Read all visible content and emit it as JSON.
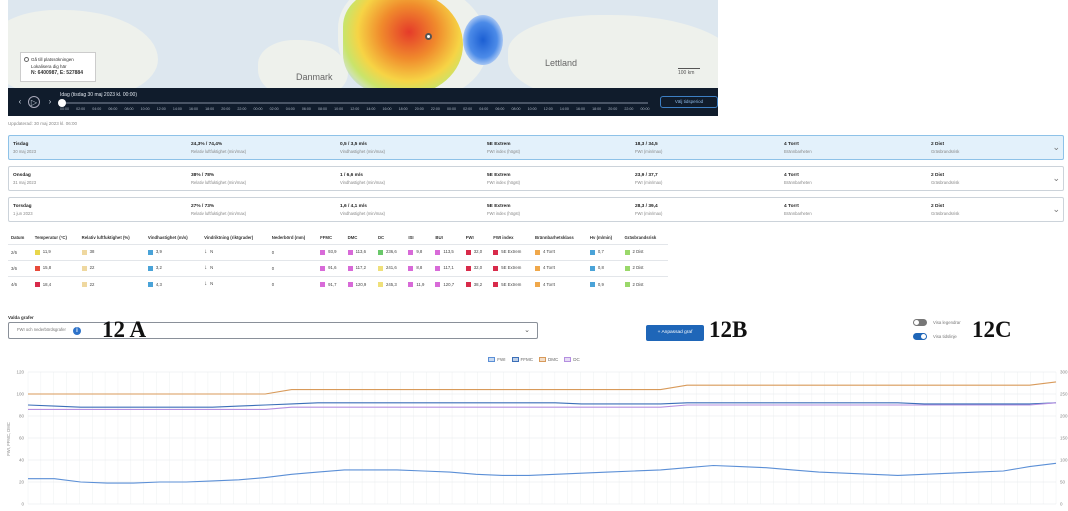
{
  "map": {
    "labels": [
      "Danmark",
      "Lettland"
    ],
    "location_box": {
      "line1": "Gå till platssökningen",
      "line2": "Lokalisera dig här",
      "coords": "N: 6400987, E: 527884"
    },
    "scale": "100 km"
  },
  "timebar": {
    "date_label": "Idag (tisdag 30 maj 2023 kl. 00:00)",
    "hours": [
      "00:00",
      "02:00",
      "04:00",
      "06:00",
      "08:00",
      "10:00",
      "12:00",
      "14:00",
      "16:00",
      "18:00",
      "20:00",
      "22:00",
      "00:00",
      "02:00",
      "04:00",
      "06:00",
      "08:00",
      "10:00",
      "12:00",
      "14:00",
      "16:00",
      "18:00",
      "20:00",
      "22:00",
      "00:00",
      "02:00",
      "04:00",
      "06:00",
      "08:00",
      "10:00",
      "12:00",
      "14:00",
      "16:00",
      "18:00",
      "20:00",
      "22:00",
      "00:00"
    ],
    "selected_button": "Välj tidsperiod",
    "prev_icon": "‹",
    "play_icon": "▷",
    "next_icon": "›"
  },
  "updated": "Uppdaterad: 30 maj 2023 kl. 06:00",
  "days": [
    {
      "day": "Tisdag",
      "date": "30 maj 2023",
      "humidity": "24,3% / 74,4%",
      "humidity_sub": "Relativ luftfuktighet (min/max)",
      "wind": "0,5 / 3,5 m/s",
      "wind_sub": "Vindhastighet (min/max)",
      "fwi": "5E Extrem",
      "fwi_sub": "FWI index (högst)",
      "temp": "18,3 / 34,5",
      "temp_sub": "FWI (min/max)",
      "burn": "4 Torrt",
      "burn_sub": "Brännbarheten",
      "spread": "2 Dist",
      "spread_sub": "Gräsbrandsrisk"
    },
    {
      "day": "Onsdag",
      "date": "31 maj 2023",
      "humidity": "38% / 78%",
      "humidity_sub": "Relativ luftfuktighet (min/max)",
      "wind": "1 / 6,6 m/s",
      "wind_sub": "Vindhastighet (min/max)",
      "fwi": "5E Extrem",
      "fwi_sub": "FWI index (högst)",
      "temp": "23,9 / 37,7",
      "temp_sub": "FWI (min/max)",
      "burn": "4 Torrt",
      "burn_sub": "Brännbarheten",
      "spread": "2 Dist",
      "spread_sub": "Gräsbrandsrisk"
    },
    {
      "day": "Torsdag",
      "date": "1 jun 2023",
      "humidity": "27% / 73%",
      "humidity_sub": "Relativ luftfuktighet (min/max)",
      "wind": "1,6 / 4,1 m/s",
      "wind_sub": "Vindhastighet (min/max)",
      "fwi": "5E Extrem",
      "fwi_sub": "FWI index (högst)",
      "temp": "28,3 / 39,4",
      "temp_sub": "FWI (min/max)",
      "burn": "4 Torrt",
      "burn_sub": "Brännbarheten",
      "spread": "2 Dist",
      "spread_sub": "Gräsbrandsrisk"
    }
  ],
  "table": {
    "headers": [
      "Datum",
      "Temperatur (°C)",
      "Relativ luftfuktighet (%)",
      "Vindhastighet (m/s)",
      "Vindriktning (riktgrader)",
      "Nederbörd (mm)",
      "FFMC",
      "DMC",
      "DC",
      "ISI",
      "BUI",
      "FWI",
      "FWI index",
      "Brännbarhetsklass",
      "Hv (m/min)",
      "Gräsbrandsrisk"
    ],
    "rows": [
      [
        "2/6",
        "11,9",
        "38",
        "3,9",
        "N",
        "0",
        "93,9",
        "113,6",
        "236,6",
        "9,8",
        "113,5",
        "32,0",
        "5E Extrem",
        "4 Torrt",
        "0,7",
        "2 Dist"
      ],
      [
        "3/6",
        "15,8",
        "22",
        "3,2",
        "N",
        "0",
        "91,6",
        "117,2",
        "241,6",
        "8,8",
        "117,1",
        "32,0",
        "5E Extrem",
        "4 Torrt",
        "0,8",
        "2 Dist"
      ],
      [
        "4/6",
        "18,4",
        "22",
        "4,3",
        "N",
        "0",
        "91,7",
        "120,9",
        "245,3",
        "11,9",
        "120,7",
        "38,2",
        "5E Extrem",
        "4 Torrt",
        "0,9",
        "2 Dist"
      ]
    ],
    "colors": [
      [
        "#e8d64a",
        "#efd8a0",
        "#4aa3d8",
        "",
        "",
        "#d86ad8",
        "#d86ad8",
        "#6ac86a",
        "#d86ad8",
        "#d86ad8",
        "#d82a4a",
        "#d82a4a",
        "#f0a84a",
        "#4aa3d8",
        "#9ad86a"
      ],
      [
        "#e84a3a",
        "#efd8a0",
        "#4aa3d8",
        "",
        "",
        "#d86ad8",
        "#d86ad8",
        "#efe07a",
        "#d86ad8",
        "#d86ad8",
        "#d82a4a",
        "#d82a4a",
        "#f0a84a",
        "#4aa3d8",
        "#9ad86a"
      ],
      [
        "#d82a4a",
        "#efd8a0",
        "#4aa3d8",
        "",
        "",
        "#d86ad8",
        "#d86ad8",
        "#efe07a",
        "#d86ad8",
        "#d86ad8",
        "#d82a4a",
        "#d82a4a",
        "#f0a84a",
        "#4aa3d8",
        "#9ad86a"
      ]
    ]
  },
  "graph": {
    "section_label": "Valda grafer",
    "select_chip": "FWI och nederbördsgrafer",
    "info_icon": "i",
    "adjust_button": "+  Anpassad graf",
    "toggle1": "Visa legendrar",
    "toggle2": "Visa tidslinje"
  },
  "annotations": {
    "a": "12 A",
    "b": "12B",
    "c": "12C"
  },
  "chart_data": {
    "type": "line",
    "legend": [
      "FWI",
      "FFMC",
      "DMC",
      "DC"
    ],
    "colors": {
      "FWI": "#5b8fd6",
      "FFMC": "#3b6fb8",
      "DMC": "#d89a5a",
      "DC": "#b48fe0"
    },
    "y_left_ticks": [
      "0",
      "20",
      "40",
      "60",
      "80",
      "100",
      "120"
    ],
    "y_right_ticks": [
      "0",
      "50",
      "100",
      "150",
      "200",
      "250",
      "300"
    ],
    "ylabel": "FWI, FFMC, DMC",
    "ylim_left": [
      0,
      120
    ],
    "ylim_right": [
      0,
      300
    ],
    "n_points": 40,
    "series": [
      {
        "name": "DMC",
        "axis": "left",
        "values": [
          100,
          100,
          100,
          100,
          100,
          100,
          100,
          100,
          100,
          100,
          104,
          104,
          104,
          104,
          104,
          104,
          104,
          104,
          104,
          104,
          104,
          104,
          104,
          104,
          104,
          108,
          108,
          108,
          108,
          108,
          108,
          108,
          108,
          108,
          108,
          108,
          108,
          108,
          108,
          111
        ]
      },
      {
        "name": "FFMC",
        "axis": "left",
        "values": [
          90,
          89,
          88,
          88,
          88,
          88,
          88,
          88,
          89,
          90,
          91,
          92,
          92,
          92,
          92,
          92,
          92,
          92,
          92,
          92,
          92,
          91,
          91,
          91,
          91,
          92,
          92,
          92,
          92,
          92,
          92,
          92,
          92,
          92,
          91,
          91,
          91,
          91,
          91,
          92
        ]
      },
      {
        "name": "DC",
        "axis": "right",
        "values": [
          215,
          215,
          215,
          215,
          215,
          215,
          215,
          215,
          215,
          215,
          220,
          220,
          220,
          220,
          220,
          220,
          220,
          220,
          220,
          220,
          220,
          220,
          220,
          220,
          220,
          225,
          225,
          225,
          225,
          225,
          225,
          225,
          225,
          225,
          225,
          225,
          225,
          225,
          225,
          230
        ]
      },
      {
        "name": "FWI",
        "axis": "left",
        "values": [
          23,
          23,
          20,
          19,
          19,
          20,
          20,
          21,
          22,
          24,
          27,
          29,
          31,
          31,
          31,
          30,
          29,
          27,
          26,
          26,
          27,
          28,
          29,
          30,
          31,
          33,
          35,
          34,
          33,
          31,
          29,
          28,
          27,
          26,
          27,
          28,
          29,
          30,
          34,
          37
        ]
      }
    ]
  }
}
